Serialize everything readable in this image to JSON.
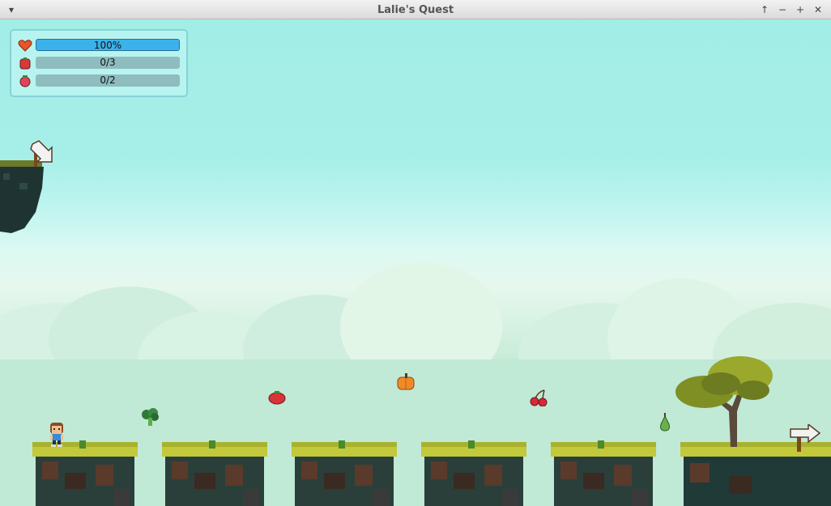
{
  "window": {
    "title": "Lalie's Quest",
    "menu_icon": "chevron-down-icon",
    "buttons": [
      "maximize-up-icon",
      "minimize-icon",
      "plus-icon",
      "close-icon"
    ]
  },
  "hud": {
    "health": {
      "icon": "heart-icon",
      "label": "100%",
      "level": 1.0
    },
    "vegetables": {
      "icon": "tomato-icon",
      "label": "0/3",
      "collected": 0,
      "total": 3
    },
    "fruits": {
      "icon": "strawberry-icon",
      "label": "0/2",
      "collected": 0,
      "total": 2
    }
  },
  "colors": {
    "sky": "#a2ede6",
    "health_fill": "#3bb2ea",
    "grass": "#c2c93a",
    "rock": "#203a38"
  },
  "scene": {
    "player": "girl-character",
    "collectibles": [
      "broccoli",
      "tomato",
      "pumpkin",
      "cherries",
      "pear"
    ],
    "signs": [
      "arrow-sign-down-right",
      "arrow-sign-right"
    ],
    "decor": [
      "tree",
      "floating-island"
    ]
  }
}
